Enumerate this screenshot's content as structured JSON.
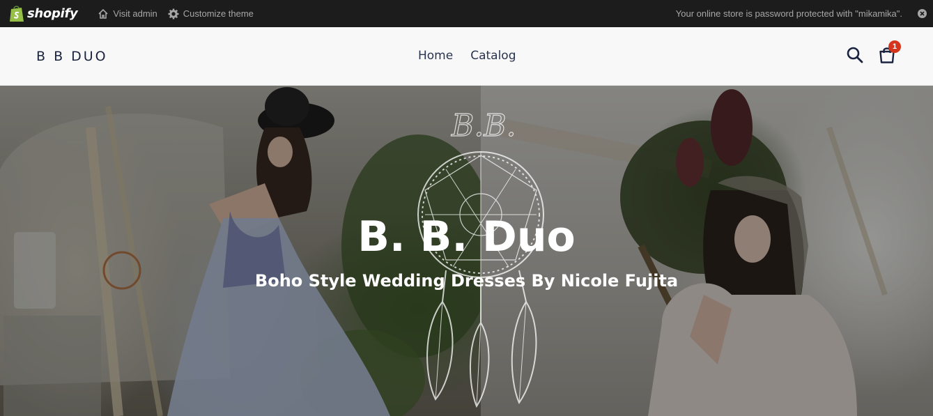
{
  "admin_bar": {
    "brand": "shopify",
    "visit_admin": "Visit admin",
    "customize_theme": "Customize theme",
    "password_message": "Your online store is password protected with \"mikamika\"."
  },
  "header": {
    "logo": "B B DUO",
    "nav": [
      {
        "label": "Home"
      },
      {
        "label": "Catalog"
      }
    ],
    "cart_count": "1"
  },
  "hero": {
    "title": "B. B. Duo",
    "subtitle": "Boho Style Wedding Dresses By Nicole Fujita",
    "logo_mark_text": "B.B."
  },
  "colors": {
    "admin_bar_bg": "#1c1c1c",
    "header_bg": "#f8f8f8",
    "nav_text": "#2a3350",
    "cart_badge": "#d4351c",
    "shopify_green": "#95bf47"
  }
}
